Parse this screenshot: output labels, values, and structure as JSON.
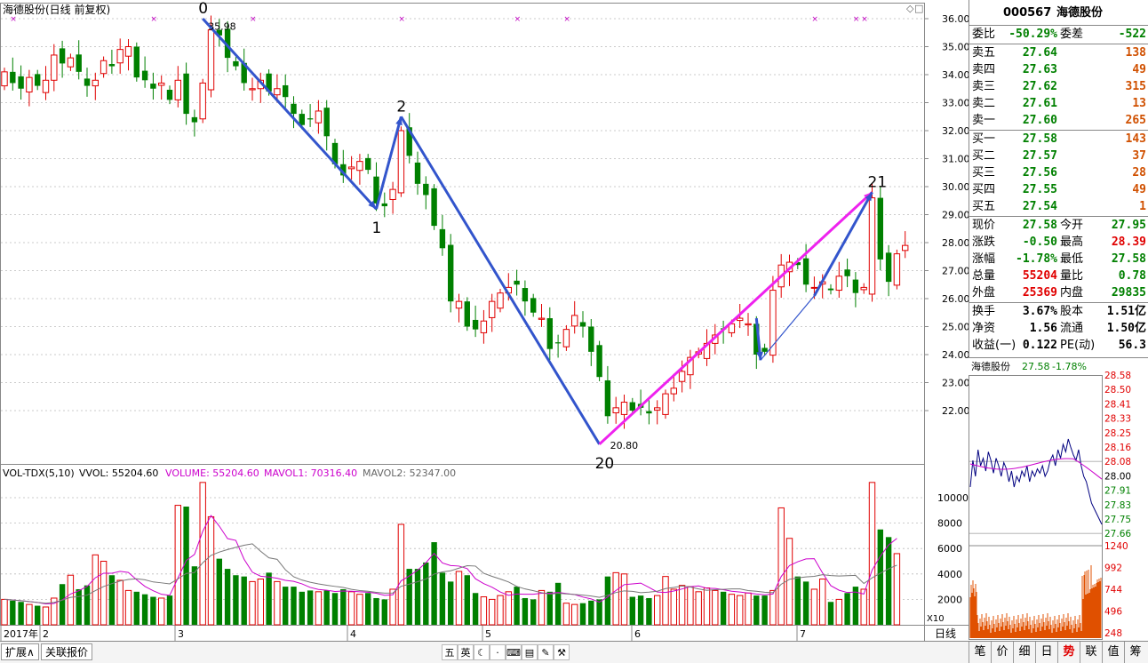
{
  "chart_title": "海德股份(日线 前复权)",
  "main_axis": {
    "ticks": [
      "36.00",
      "35.00",
      "34.00",
      "33.00",
      "32.00",
      "31.00",
      "30.00",
      "29.00",
      "28.00",
      "27.00",
      "26.00",
      "25.00",
      "24.00",
      "23.00",
      "22.00"
    ]
  },
  "wave_labels": [
    {
      "text": "0",
      "i": 24,
      "price": 36.0
    },
    {
      "text": "1",
      "i": 45,
      "price": 29.2
    },
    {
      "text": "2",
      "i": 48,
      "price": 32.5
    },
    {
      "text": "20",
      "i": 72,
      "price": 20.8
    },
    {
      "text": "21",
      "i": 105,
      "price": 29.8
    }
  ],
  "price_annotations": {
    "high": "35.98",
    "low": "20.80"
  },
  "volume_header": {
    "title": "VOL-TDX(5,10)",
    "vvol_label": "VVOL: 55204.60",
    "volume_label": "VOLUME: 55204.60",
    "mavol1_label": "MAVOL1: 70316.40",
    "mavol2_label": "MAVOL2: 52347.00"
  },
  "volume_axis": {
    "ticks": [
      "10000",
      "8000",
      "6000",
      "4000",
      "2000"
    ],
    "unit": "X10"
  },
  "date_axis": {
    "labels": [
      "2017年",
      "2",
      "3",
      "4",
      "5",
      "6",
      "7"
    ],
    "period": "日线"
  },
  "quote": {
    "code": "000567",
    "name": "海德股份",
    "weibi_label": "委比",
    "weibi": "-50.29%",
    "weicha_label": "委差",
    "weicha": "-522",
    "asks": [
      {
        "label": "卖五",
        "price": "27.64",
        "vol": "138"
      },
      {
        "label": "卖四",
        "price": "27.63",
        "vol": "49"
      },
      {
        "label": "卖三",
        "price": "27.62",
        "vol": "315"
      },
      {
        "label": "卖二",
        "price": "27.61",
        "vol": "13"
      },
      {
        "label": "卖一",
        "price": "27.60",
        "vol": "265"
      }
    ],
    "bids": [
      {
        "label": "买一",
        "price": "27.58",
        "vol": "143"
      },
      {
        "label": "买二",
        "price": "27.57",
        "vol": "37"
      },
      {
        "label": "买三",
        "price": "27.56",
        "vol": "28"
      },
      {
        "label": "买四",
        "price": "27.55",
        "vol": "49"
      },
      {
        "label": "买五",
        "price": "27.54",
        "vol": "1"
      }
    ],
    "stats": [
      {
        "l1": "现价",
        "v1": "27.58",
        "c1": "g",
        "l2": "今开",
        "v2": "27.95",
        "c2": "g"
      },
      {
        "l1": "涨跌",
        "v1": "-0.50",
        "c1": "g",
        "l2": "最高",
        "v2": "28.39",
        "c2": "r"
      },
      {
        "l1": "涨幅",
        "v1": "-1.78%",
        "c1": "g",
        "l2": "最低",
        "v2": "27.58",
        "c2": "g"
      },
      {
        "l1": "总量",
        "v1": "55204",
        "c1": "r",
        "l2": "量比",
        "v2": "0.78",
        "c2": "g"
      },
      {
        "l1": "外盘",
        "v1": "25369",
        "c1": "r",
        "l2": "内盘",
        "v2": "29835",
        "c2": "g"
      }
    ],
    "fundamentals": [
      {
        "l1": "换手",
        "v1": "3.67%",
        "l2": "股本",
        "v2": "1.51亿"
      },
      {
        "l1": "净资",
        "v1": "1.56",
        "l2": "流通",
        "v2": "1.50亿"
      },
      {
        "l1": "收益(一)",
        "v1": "0.122",
        "l2": "PE(动)",
        "v2": "56.3"
      }
    ]
  },
  "intraday": {
    "title": "海德股份",
    "price": "27.58",
    "change": "-1.78%",
    "price_ticks": [
      "28.58",
      "28.50",
      "28.41",
      "28.33",
      "28.25",
      "28.16",
      "28.08",
      "28.00",
      "27.91",
      "27.83",
      "27.75",
      "27.66"
    ],
    "vol_ticks": [
      "1240",
      "992",
      "744",
      "496",
      "248"
    ]
  },
  "bottom_tabs": [
    "扩展∧",
    "关联报价"
  ],
  "toolbar": [
    "五",
    "英",
    "☾",
    "·",
    "⌨",
    "▤",
    "✎",
    "⚒"
  ],
  "right_tabs": [
    "笔",
    "价",
    "细",
    "日",
    "势",
    "联",
    "值",
    "筹"
  ],
  "right_tabs_active": "势",
  "chart_data": {
    "type": "candlestick",
    "title": "海德股份(日线 前复权)",
    "ohlc_note": "daily bars, estimated",
    "closes": [
      34.1,
      33.7,
      33.5,
      33.9,
      33.6,
      33.8,
      34.7,
      34.4,
      34.6,
      34.1,
      33.6,
      33.8,
      34.5,
      34.3,
      34.9,
      35.0,
      33.9,
      33.8,
      33.5,
      33.7,
      33.1,
      33.8,
      32.6,
      32.3,
      33.7,
      35.6,
      35.4,
      34.6,
      34.3,
      33.7,
      33.5,
      33.8,
      33.4,
      33.5,
      33.2,
      32.6,
      32.2,
      32.4,
      32.7,
      31.8,
      30.8,
      30.4,
      30.7,
      30.9,
      30.6,
      29.4,
      29.3,
      29.9,
      32.0,
      31.1,
      30.1,
      29.7,
      28.6,
      27.8,
      25.9,
      25.9,
      25.0,
      24.9,
      25.2,
      25.9,
      26.2,
      26.4,
      26.5,
      25.9,
      25.5,
      25.3,
      24.2,
      24.4,
      24.9,
      25.4,
      25.0,
      24.1,
      23.2,
      21.8,
      22.1,
      22.3,
      22.0,
      22.1,
      21.9,
      22.1,
      22.6,
      22.8,
      23.4,
      23.9,
      24.1,
      24.4,
      24.7,
      24.9,
      25.1,
      25.3,
      25.1,
      24.0,
      24.1,
      26.3,
      27.2,
      27.3,
      27.2,
      26.5,
      26.4,
      26.6,
      26.3,
      26.8,
      26.8,
      26.2,
      26.4,
      29.6,
      27.4,
      26.6,
      27.6,
      27.9
    ],
    "volumes": [
      2000,
      1900,
      1800,
      1600,
      1500,
      1400,
      2100,
      3200,
      3900,
      2800,
      3100,
      5500,
      5000,
      3900,
      3500,
      2700,
      2600,
      2400,
      2200,
      2100,
      2300,
      9400,
      9300,
      4600,
      11200,
      8500,
      5200,
      4400,
      3900,
      3800,
      3400,
      3600,
      4100,
      3400,
      3000,
      3000,
      2600,
      2700,
      2600,
      2700,
      2500,
      2800,
      2600,
      2400,
      2500,
      2100,
      2000,
      2800,
      7900,
      4400,
      4400,
      4900,
      6500,
      4100,
      3400,
      4200,
      3900,
      2500,
      2200,
      2000,
      2300,
      2600,
      3000,
      2100,
      2000,
      2700,
      2600,
      3300,
      1700,
      1600,
      1700,
      1900,
      2000,
      3800,
      4100,
      4000,
      2200,
      2300,
      2100,
      2300,
      3800,
      2800,
      3100,
      3000,
      2600,
      2900,
      2700,
      2600,
      2400,
      2300,
      2500,
      2300,
      2300,
      2700,
      9200,
      6800,
      3800,
      3400,
      2800,
      3600,
      1800,
      2000,
      2500,
      3000,
      2800,
      11200,
      7500,
      6900,
      5600
    ],
    "up_volume_flags": "red hollow = up, green solid = down"
  }
}
